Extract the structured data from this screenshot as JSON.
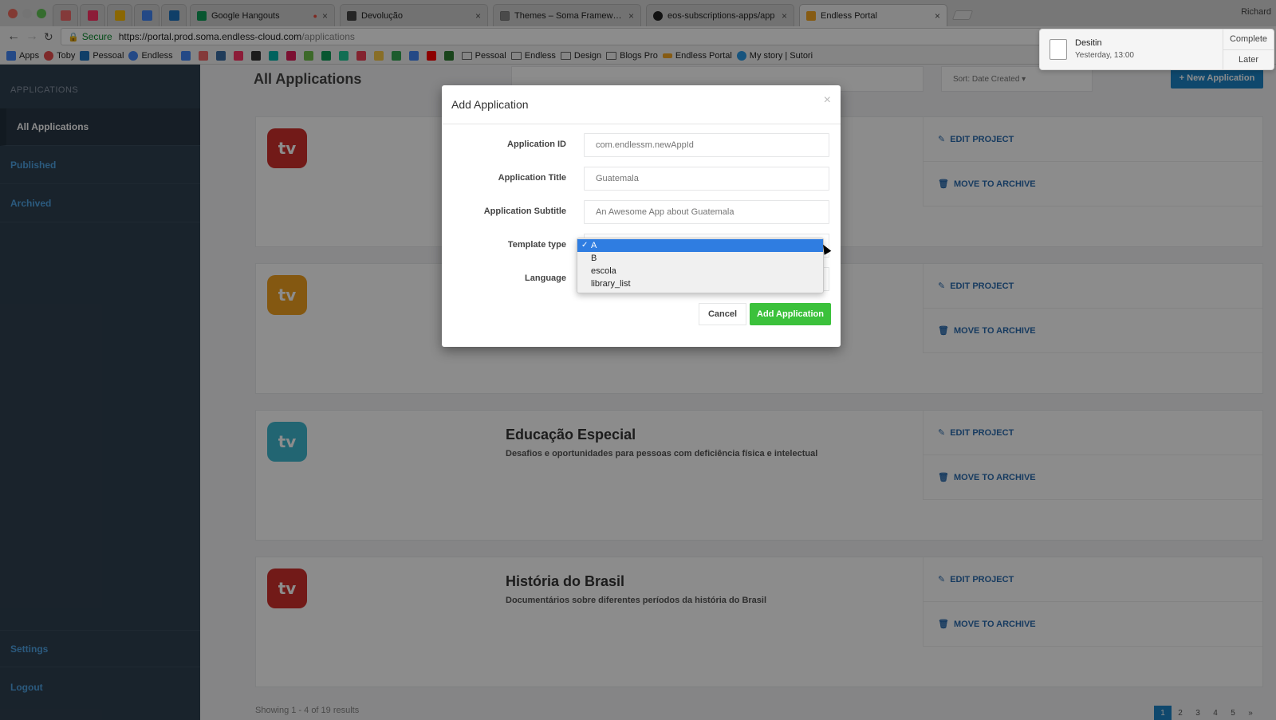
{
  "browser": {
    "tabs": [
      {
        "label": "Google Hangouts",
        "favicon_color": "#0f9d58"
      },
      {
        "label": "Devolução",
        "favicon_color": "#444444"
      },
      {
        "label": "Themes – Soma Framework",
        "favicon_color": "#888888"
      },
      {
        "label": "eos-subscriptions-apps/app",
        "favicon_color": "#222222"
      },
      {
        "label": "Endless Portal",
        "favicon_color": "#f5a623"
      }
    ],
    "pinned_tabs": [
      {
        "icon": "asana-icon",
        "color": "#f06a6a"
      },
      {
        "icon": "invision-icon",
        "color": "#ff3366"
      },
      {
        "icon": "drive-icon",
        "color": "#fbbc05"
      },
      {
        "icon": "calendar-icon",
        "color": "#4285f4"
      },
      {
        "icon": "mail-icon",
        "color": "#1e73be"
      }
    ],
    "profile": "Richard",
    "url": {
      "secure_label": "Secure",
      "base": "https://portal.prod.soma.endless-cloud.com",
      "path": "/applications"
    },
    "bookmarks": [
      {
        "label": "Apps",
        "icon": "apps-grid-icon",
        "color": "#4285f4"
      },
      {
        "label": "Toby",
        "icon": "toby-icon",
        "color": "#e54b4b"
      },
      {
        "label": "Pessoal",
        "icon": "mail-icon",
        "color": "#1e73be"
      },
      {
        "label": "Endless",
        "icon": "google-icon",
        "color": "#4285f4"
      },
      {
        "label": "Pessoal",
        "icon": "folder-icon",
        "folder": true
      },
      {
        "label": "Endless",
        "icon": "folder-icon",
        "folder": true
      },
      {
        "label": "Design",
        "icon": "folder-icon",
        "folder": true
      },
      {
        "label": "Blogs Pro",
        "icon": "folder-icon",
        "folder": true
      },
      {
        "label": "Endless Portal",
        "icon": "endless-icon",
        "color": "#f5a623"
      },
      {
        "label": "My story | Sutori",
        "icon": "sutori-icon",
        "color": "#2b9ae6"
      }
    ],
    "icon_only_bookmarks": [
      "#4285f4",
      "#f06a6a",
      "#3b6ea5",
      "#ff3366",
      "#333333",
      "#00b2a9",
      "#e01e5a",
      "#6fbf4b",
      "#0f9d58",
      "#20c997",
      "#ef4056",
      "#f7c948",
      "#34a853",
      "#4285f4",
      "#ff0000",
      "#2e7d32"
    ]
  },
  "notification": {
    "title": "Desitin",
    "subtitle": "Yesterday, 13:00",
    "complete": "Complete",
    "later": "Later"
  },
  "sidebar": {
    "header": "APPLICATIONS",
    "items": [
      {
        "label": "All Applications",
        "active": true
      },
      {
        "label": "Published"
      },
      {
        "label": "Archived"
      }
    ],
    "settings": "Settings",
    "logout": "Logout"
  },
  "main": {
    "title": "All Applications",
    "sort_label": "Sort: Date Created ▾",
    "new_button": "+ New Application",
    "cards": [
      {
        "title": "",
        "subtitle": "",
        "logo_text": "tv",
        "logo_color": "#d0312d"
      },
      {
        "title": "",
        "subtitle": "",
        "logo_text": "tv",
        "logo_color": "#f0a020"
      },
      {
        "title": "Educação Especial",
        "subtitle": "Desafios e oportunidades para pessoas com deficiência física e intelectual",
        "logo_text": "tv",
        "logo_color": "#3fb8d0"
      },
      {
        "title": "História do Brasil",
        "subtitle": "Documentários sobre diferentes períodos da história do Brasil",
        "logo_text": "tv",
        "logo_color": "#d0312d"
      }
    ],
    "edit_label": "EDIT PROJECT",
    "archive_label": "MOVE TO ARCHIVE",
    "results_text": "Showing 1 - 4 of 19 results",
    "pages": [
      "1",
      "2",
      "3",
      "4",
      "5",
      "»"
    ]
  },
  "modal": {
    "title": "Add Application",
    "close": "×",
    "fields": {
      "app_id": {
        "label": "Application ID",
        "placeholder": "com.endlessm.newAppId"
      },
      "app_title": {
        "label": "Application Title",
        "placeholder": "Guatemala"
      },
      "app_subtitle": {
        "label": "Application Subtitle",
        "placeholder": "An Awesome App about Guatemala"
      },
      "template": {
        "label": "Template type",
        "selected": "A",
        "options": [
          "A",
          "B",
          "escola",
          "library_list"
        ]
      },
      "language": {
        "label": "Language"
      }
    },
    "cancel": "Cancel",
    "submit": "Add Application"
  }
}
